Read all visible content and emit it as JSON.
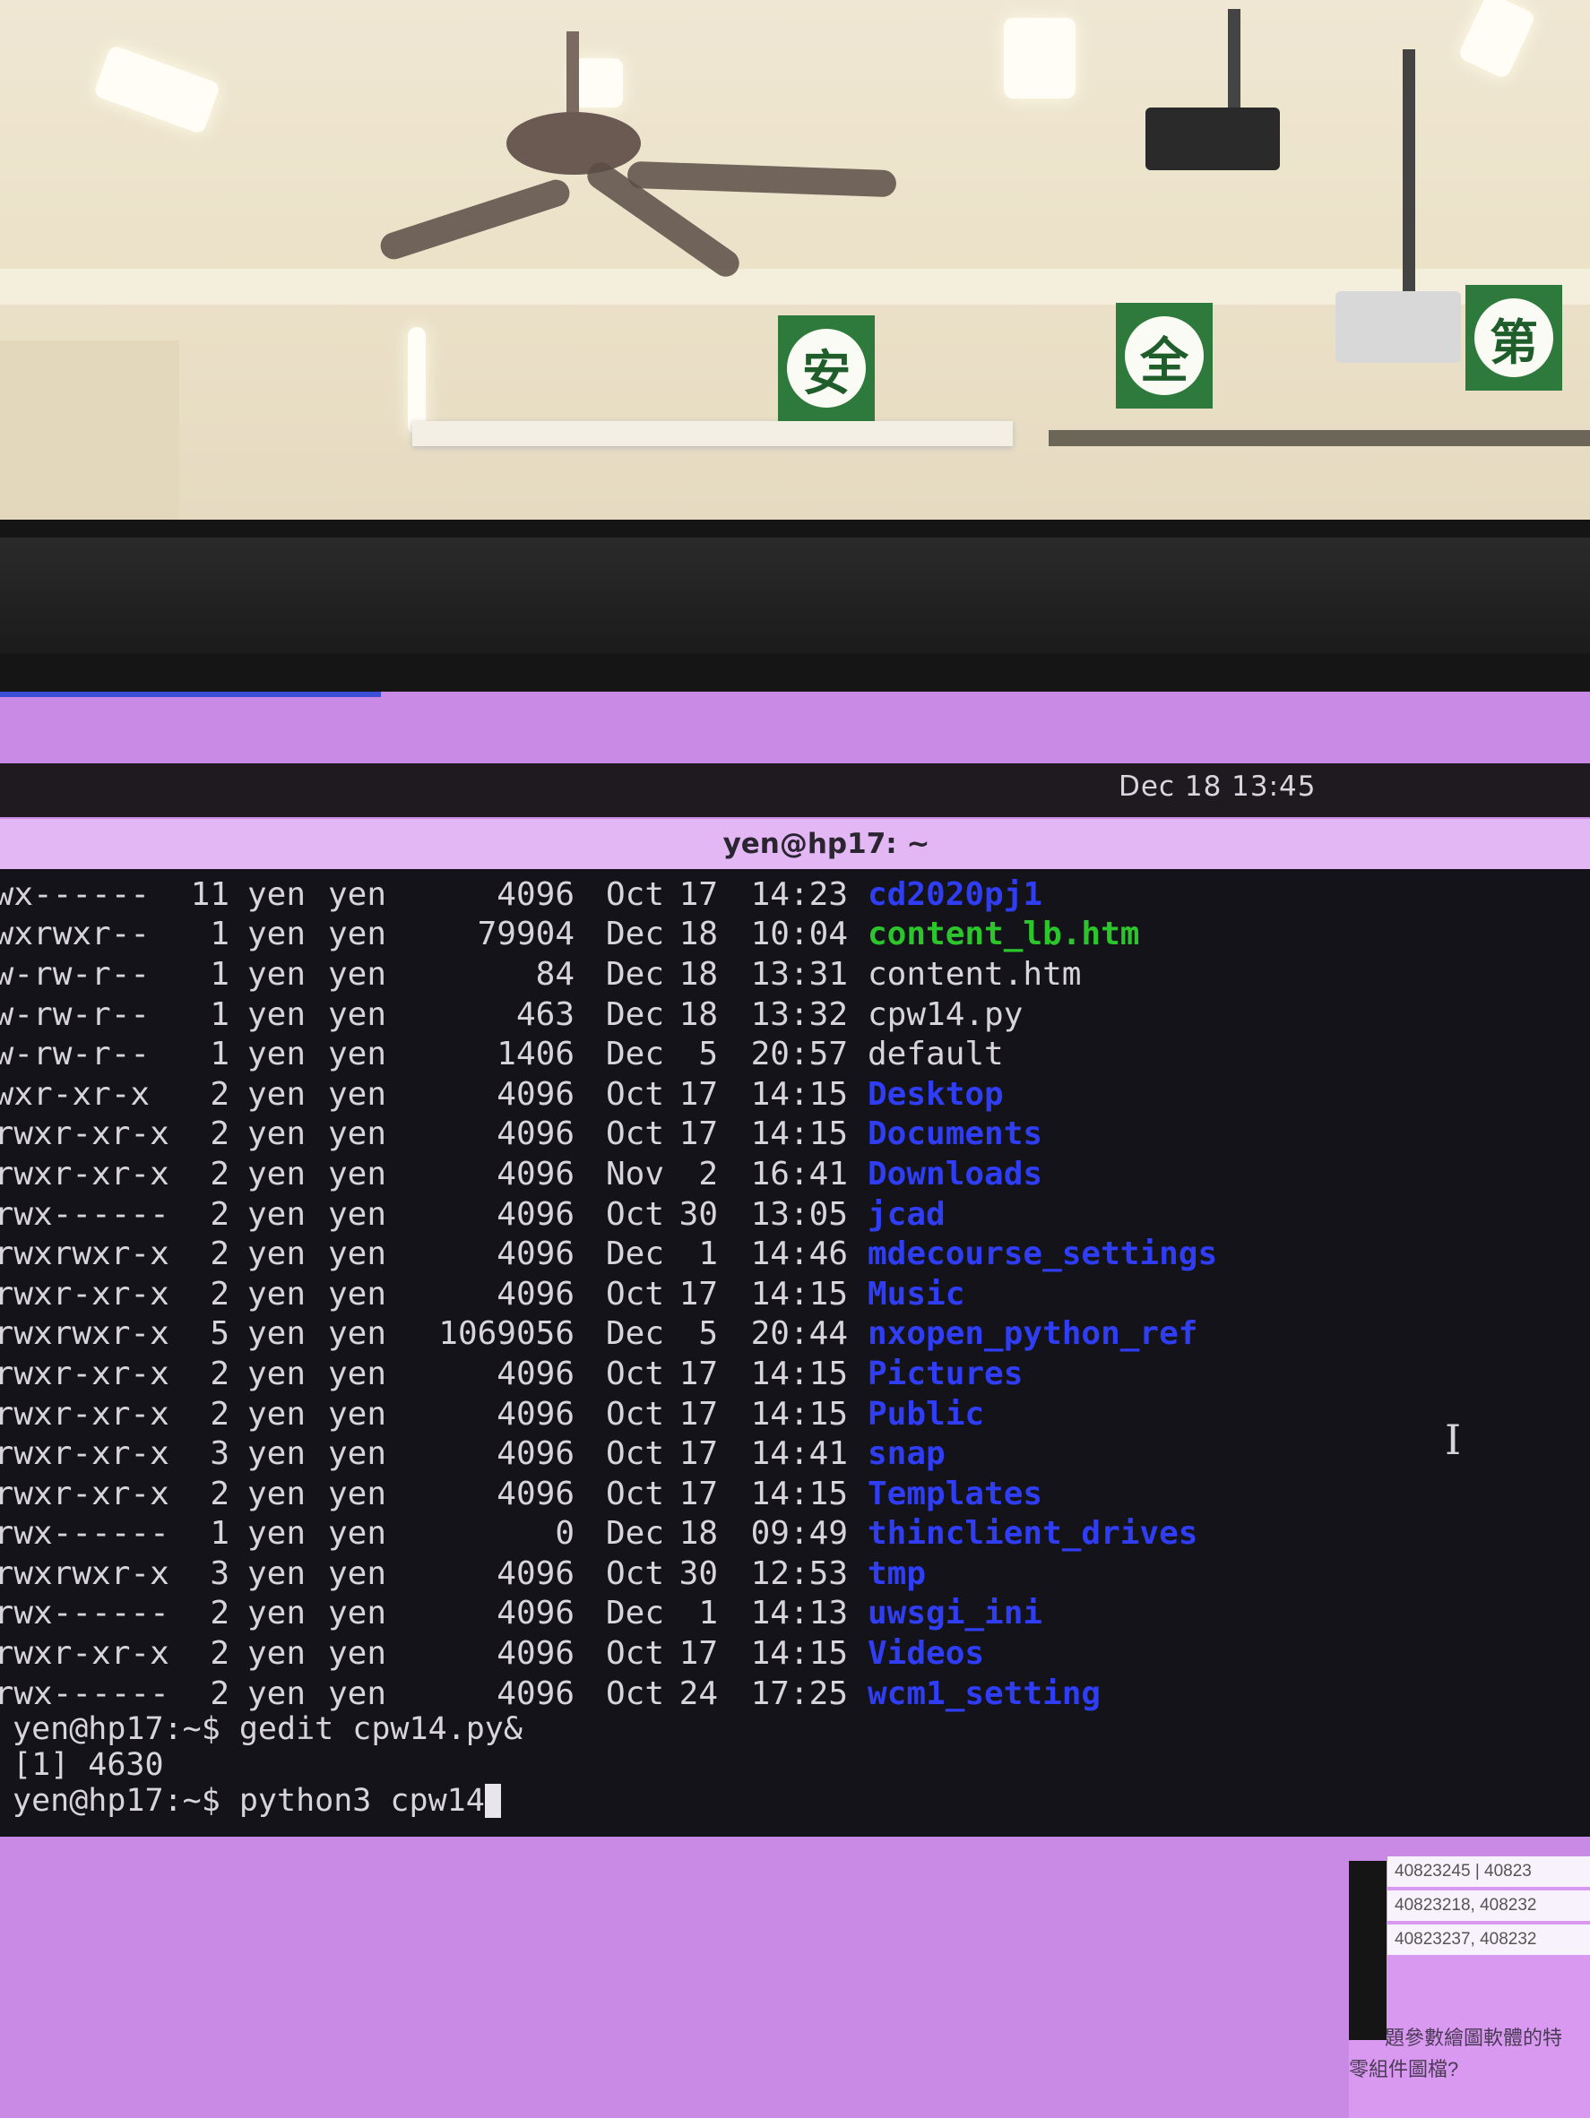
{
  "topbar": {
    "clock": "Dec 18 13:45"
  },
  "window": {
    "title": "yen@hp17: ~"
  },
  "listing": [
    {
      "perm": "rwx------",
      "links": "11",
      "owner": "yen",
      "group": "yen",
      "size": "4096",
      "month": "Oct",
      "day": "17",
      "time": "14:23",
      "name": "cd2020pj1",
      "kind": "dir"
    },
    {
      "perm": "rwxrwxr--",
      "links": "1",
      "owner": "yen",
      "group": "yen",
      "size": "79904",
      "month": "Dec",
      "day": "18",
      "time": "10:04",
      "name": "content_lb.htm",
      "kind": "exec"
    },
    {
      "perm": "rw-rw-r--",
      "links": "1",
      "owner": "yen",
      "group": "yen",
      "size": "84",
      "month": "Dec",
      "day": "18",
      "time": "13:31",
      "name": "content.htm",
      "kind": "file"
    },
    {
      "perm": "rw-rw-r--",
      "links": "1",
      "owner": "yen",
      "group": "yen",
      "size": "463",
      "month": "Dec",
      "day": "18",
      "time": "13:32",
      "name": "cpw14.py",
      "kind": "file"
    },
    {
      "perm": "rw-rw-r--",
      "links": "1",
      "owner": "yen",
      "group": "yen",
      "size": "1406",
      "month": "Dec",
      "day": "5",
      "time": "20:57",
      "name": "default",
      "kind": "file"
    },
    {
      "perm": "rwxr-xr-x",
      "links": "2",
      "owner": "yen",
      "group": "yen",
      "size": "4096",
      "month": "Oct",
      "day": "17",
      "time": "14:15",
      "name": "Desktop",
      "kind": "dir"
    },
    {
      "perm": "irwxr-xr-x",
      "links": "2",
      "owner": "yen",
      "group": "yen",
      "size": "4096",
      "month": "Oct",
      "day": "17",
      "time": "14:15",
      "name": "Documents",
      "kind": "dir"
    },
    {
      "perm": "lrwxr-xr-x",
      "links": "2",
      "owner": "yen",
      "group": "yen",
      "size": "4096",
      "month": "Nov",
      "day": "2",
      "time": "16:41",
      "name": "Downloads",
      "kind": "dir"
    },
    {
      "perm": "Irwx------",
      "links": "2",
      "owner": "yen",
      "group": "yen",
      "size": "4096",
      "month": "Oct",
      "day": "30",
      "time": "13:05",
      "name": "jcad",
      "kind": "dir"
    },
    {
      "perm": "drwxrwxr-x",
      "links": "2",
      "owner": "yen",
      "group": "yen",
      "size": "4096",
      "month": "Dec",
      "day": "1",
      "time": "14:46",
      "name": "mdecourse_settings",
      "kind": "dir"
    },
    {
      "perm": "drwxr-xr-x",
      "links": "2",
      "owner": "yen",
      "group": "yen",
      "size": "4096",
      "month": "Oct",
      "day": "17",
      "time": "14:15",
      "name": "Music",
      "kind": "dir"
    },
    {
      "perm": "drwxrwxr-x",
      "links": "5",
      "owner": "yen",
      "group": "yen",
      "size": "1069056",
      "month": "Dec",
      "day": "5",
      "time": "20:44",
      "name": "nxopen_python_ref",
      "kind": "dir"
    },
    {
      "perm": "drwxr-xr-x",
      "links": "2",
      "owner": "yen",
      "group": "yen",
      "size": "4096",
      "month": "Oct",
      "day": "17",
      "time": "14:15",
      "name": "Pictures",
      "kind": "dir"
    },
    {
      "perm": "drwxr-xr-x",
      "links": "2",
      "owner": "yen",
      "group": "yen",
      "size": "4096",
      "month": "Oct",
      "day": "17",
      "time": "14:15",
      "name": "Public",
      "kind": "dir"
    },
    {
      "perm": "drwxr-xr-x",
      "links": "3",
      "owner": "yen",
      "group": "yen",
      "size": "4096",
      "month": "Oct",
      "day": "17",
      "time": "14:41",
      "name": "snap",
      "kind": "dir"
    },
    {
      "perm": "drwxr-xr-x",
      "links": "2",
      "owner": "yen",
      "group": "yen",
      "size": "4096",
      "month": "Oct",
      "day": "17",
      "time": "14:15",
      "name": "Templates",
      "kind": "dir"
    },
    {
      "perm": "drwx------",
      "links": "1",
      "owner": "yen",
      "group": "yen",
      "size": "0",
      "month": "Dec",
      "day": "18",
      "time": "09:49",
      "name": "thinclient_drives",
      "kind": "dir"
    },
    {
      "perm": "drwxrwxr-x",
      "links": "3",
      "owner": "yen",
      "group": "yen",
      "size": "4096",
      "month": "Oct",
      "day": "30",
      "time": "12:53",
      "name": "tmp",
      "kind": "dir"
    },
    {
      "perm": "drwx------",
      "links": "2",
      "owner": "yen",
      "group": "yen",
      "size": "4096",
      "month": "Dec",
      "day": "1",
      "time": "14:13",
      "name": "uwsgi_ini",
      "kind": "dir"
    },
    {
      "perm": "drwxr-xr-x",
      "links": "2",
      "owner": "yen",
      "group": "yen",
      "size": "4096",
      "month": "Oct",
      "day": "17",
      "time": "14:15",
      "name": "Videos",
      "kind": "dir"
    },
    {
      "perm": "drwx------",
      "links": "2",
      "owner": "yen",
      "group": "yen",
      "size": "4096",
      "month": "Oct",
      "day": "24",
      "time": "17:25",
      "name": "wcm1_setting",
      "kind": "dir"
    }
  ],
  "commands": [
    "yen@hp17:~$ gedit cpw14.py&",
    "[1] 4630",
    "yen@hp17:~$ python3 cpw14"
  ],
  "colors": {
    "dir": "#2f3df5",
    "exec": "#2cc52c",
    "file": "#d8d4dc",
    "desktop": "#c98ae6"
  },
  "background_window": {
    "cells": [
      "40823245 | 40823",
      "40823218, 408232",
      "40823237, 408232"
    ],
    "text_lines": [
      "題參數繪圖軟體的特",
      "零組件圖檔?"
    ]
  },
  "room_signs": [
    "安",
    "全",
    "第"
  ]
}
